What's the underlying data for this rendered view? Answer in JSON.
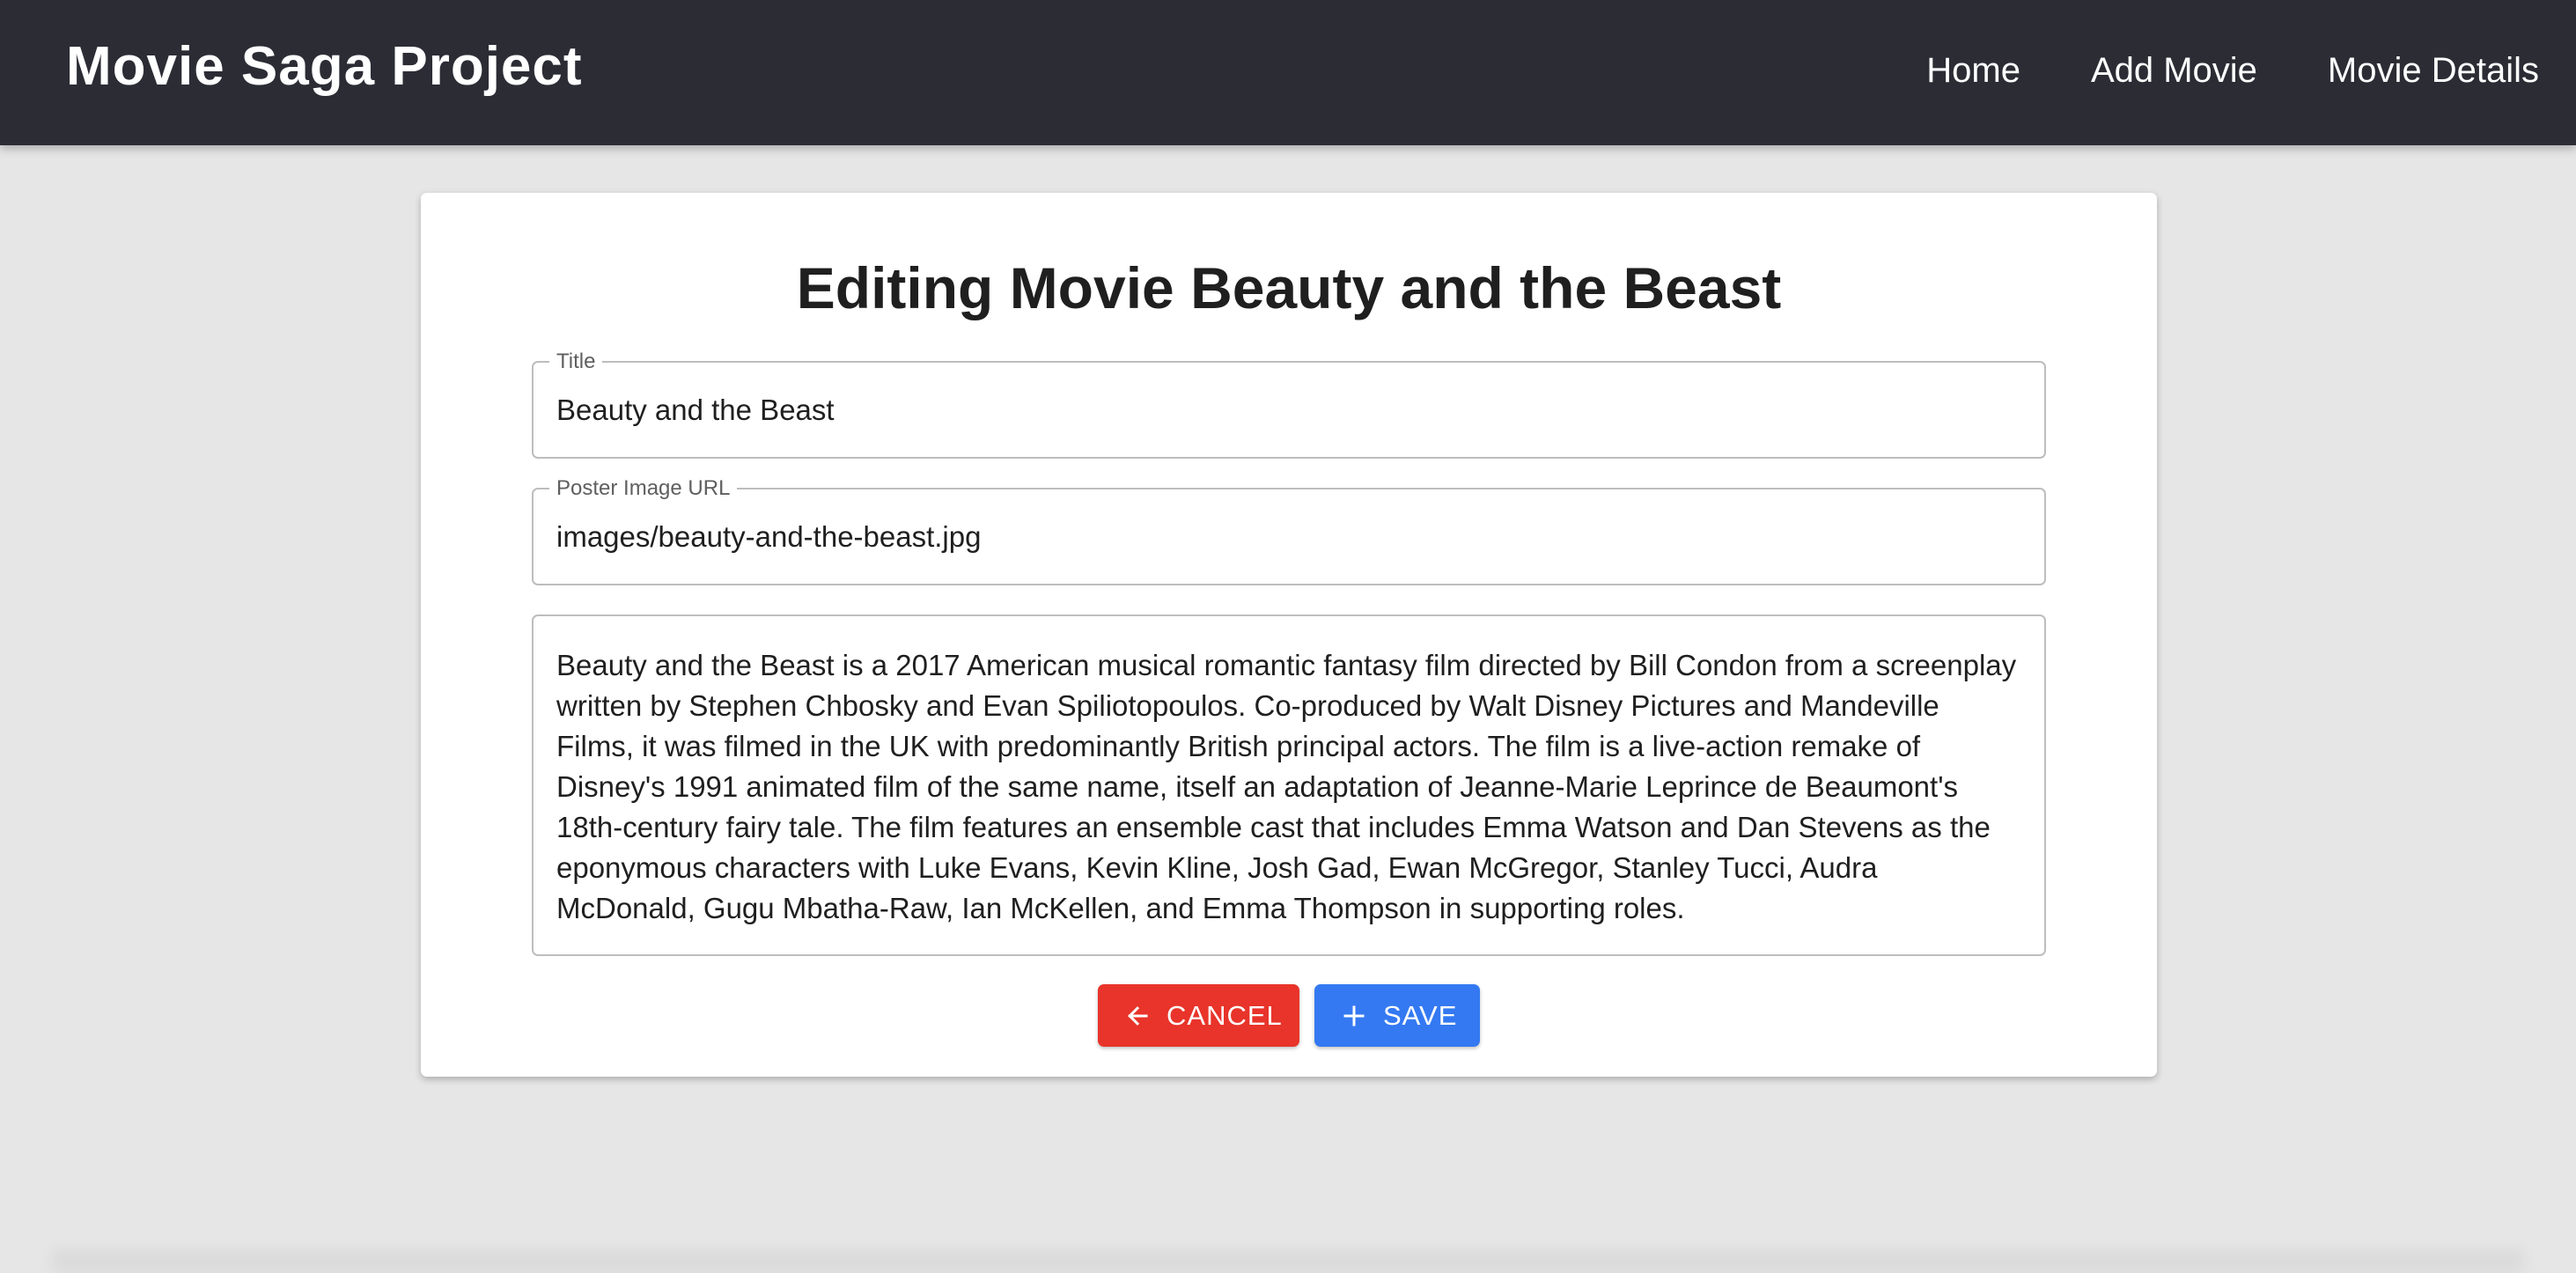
{
  "app": {
    "brand": "Movie Saga Project"
  },
  "nav": {
    "items": [
      {
        "label": "Home"
      },
      {
        "label": "Add Movie"
      },
      {
        "label": "Movie Details"
      }
    ]
  },
  "form": {
    "heading": "Editing Movie Beauty and the Beast",
    "title_field": {
      "label": "Title",
      "value": "Beauty and the Beast"
    },
    "poster_field": {
      "label": "Poster Image URL",
      "value": "images/beauty-and-the-beast.jpg"
    },
    "description_field": {
      "value": "Beauty and the Beast is a 2017 American musical romantic fantasy film directed by Bill Condon from a screenplay written by Stephen Chbosky and Evan Spiliotopoulos. Co-produced by Walt Disney Pictures and Mandeville Films, it was filmed in the UK with predominantly British principal actors. The film is a live-action remake of Disney's 1991 animated film of the same name, itself an adaptation of Jeanne-Marie Leprince de Beaumont's 18th-century fairy tale. The film features an ensemble cast that includes Emma Watson and Dan Stevens as the eponymous characters with Luke Evans, Kevin Kline, Josh Gad, Ewan McGregor, Stanley Tucci, Audra McDonald, Gugu Mbatha-Raw, Ian McKellen, and Emma Thompson in supporting roles."
    },
    "cancel_button": {
      "label": "CANCEL",
      "icon": "arrow-left-icon",
      "color": "#e8342a"
    },
    "save_button": {
      "label": "SAVE",
      "icon": "plus-icon",
      "color": "#3479f2"
    }
  },
  "colors": {
    "navbar": "#2b2c34",
    "background": "#e6e6e6",
    "card": "#ffffff"
  }
}
